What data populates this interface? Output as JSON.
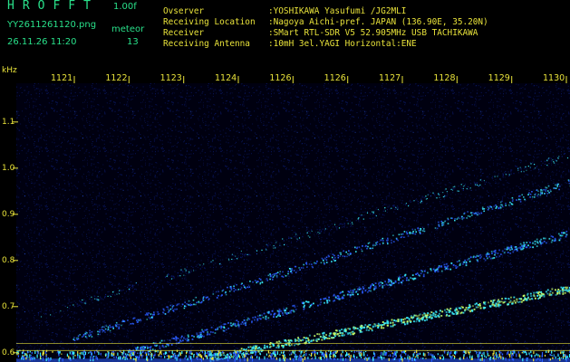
{
  "header": {
    "app_name": "HROFFT",
    "version": "1.00f",
    "filename": "YY2611261120.png",
    "datetime": "26.11.26 11:20",
    "meteor_label": "meteor",
    "meteor_count": "13",
    "info": [
      {
        "label": "Ovserver",
        "value": ":YOSHIKAWA Yasufumi /JG2MLI"
      },
      {
        "label": "Receiving Location",
        "value": ":Nagoya Aichi-pref. JAPAN (136.90E, 35.20N)"
      },
      {
        "label": "Receiver",
        "value": ":SMart RTL-SDR V5 52.905MHz USB TACHIKAWA"
      },
      {
        "label": "Receiving Antenna",
        "value": ":10mH 3el.YAGI Horizontal:ENE"
      }
    ]
  },
  "colors": {
    "background": "#000000",
    "label_green": "#29e08a",
    "label_yellow": "#e8e23a",
    "spectrum_low": "#0a1a70",
    "spectrum_mid": "#2a5cff",
    "spectrum_high": "#39f0ff"
  },
  "spectrogram": {
    "y_unit": "kHz",
    "y_labels": [
      "1.1",
      "1.0",
      "0.9",
      "0.8",
      "0.7",
      "0.6"
    ],
    "y_values": [
      1.1,
      1.0,
      0.9,
      0.8,
      0.7,
      0.6
    ],
    "time_labels": [
      "1121",
      "1122",
      "1123",
      "1124",
      "1126",
      "1126",
      "1127",
      "1128",
      "1129",
      "1130"
    ],
    "y_range": [
      0.58,
      1.18
    ],
    "reference_lines_khz": [
      0.62,
      0.605
    ]
  }
}
